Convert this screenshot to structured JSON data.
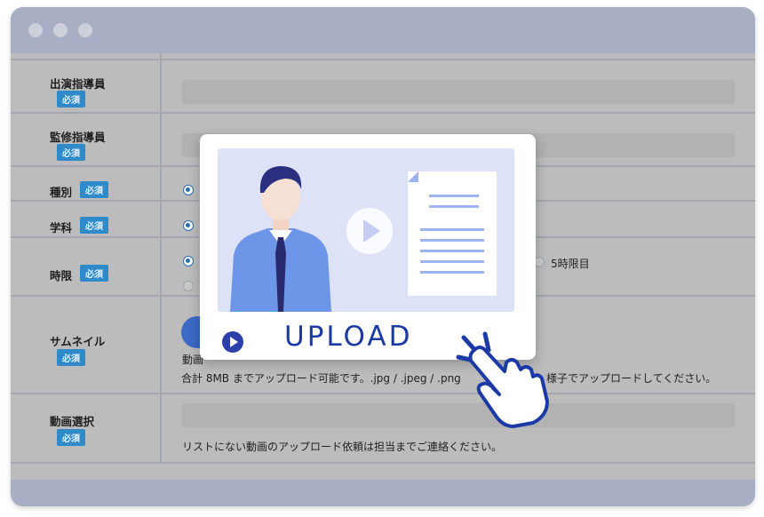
{
  "window": {
    "controls": [
      "close",
      "minimize",
      "maximize"
    ]
  },
  "form": {
    "required_badge": "必須",
    "rows": [
      {
        "label": "出演指導員"
      },
      {
        "label": "監修指導員"
      },
      {
        "label": "種別"
      },
      {
        "label": "学科"
      },
      {
        "label": "時限",
        "visible_option": "5時限目"
      },
      {
        "label": "サムネイル",
        "hint_prefix": "動画",
        "hint_line2": "合計 8MB までアップロード可能です。.jpg / .jpeg / .png",
        "hint_line2_end": "様子でアップロードしてください。"
      },
      {
        "label": "動画選択",
        "note": "リストにない動画のアップロード依頼は担当までご連絡ください。"
      }
    ]
  },
  "overlay": {
    "upload_label": "UPLOAD",
    "colors": {
      "accent": "#1b3aa6",
      "illustration_bg": "#dde2f6"
    }
  }
}
